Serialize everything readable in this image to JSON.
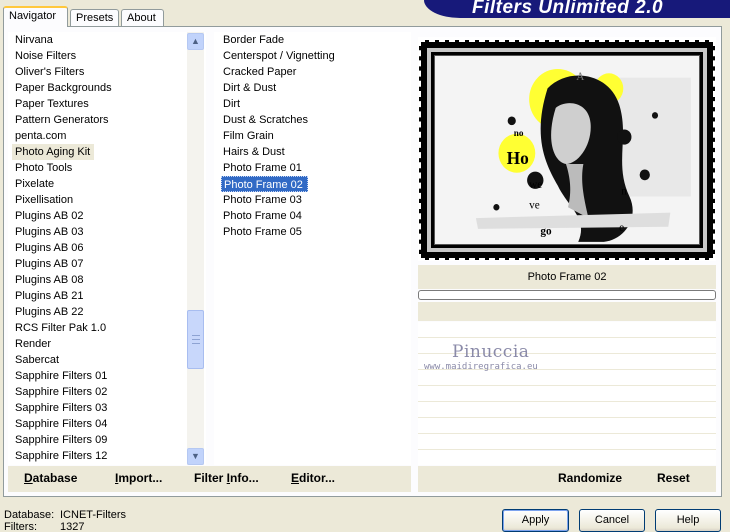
{
  "tabs": [
    "Navigator",
    "Presets",
    "About"
  ],
  "banner_title": "Filters Unlimited 2.0",
  "categories": [
    "Nirvana",
    "Noise Filters",
    "Oliver's Filters",
    "Paper Backgrounds",
    "Paper Textures",
    "Pattern Generators",
    "penta.com",
    "Photo Aging Kit",
    "Photo Tools",
    "Pixelate",
    "Pixellisation",
    "Plugins AB 02",
    "Plugins AB 03",
    "Plugins AB 06",
    "Plugins AB 07",
    "Plugins AB 08",
    "Plugins AB 21",
    "Plugins AB 22",
    "RCS Filter Pak 1.0",
    "Render",
    "Sabercat",
    "Sapphire Filters 01",
    "Sapphire Filters 02",
    "Sapphire Filters 03",
    "Sapphire Filters 04",
    "Sapphire Filters 09",
    "Sapphire Filters 12"
  ],
  "selected_category": "Photo Aging Kit",
  "filters": [
    "Border Fade",
    "Centerspot / Vignetting",
    "Cracked Paper",
    "Dirt & Dust",
    "Dirt",
    "Dust & Scratches",
    "Film Grain",
    "Hairs & Dust",
    "Photo Frame 01",
    "Photo Frame 02",
    "Photo Frame 03",
    "Photo Frame 04",
    "Photo Frame 05"
  ],
  "selected_filter": "Photo Frame 02",
  "preview_filter_name": "Photo Frame 02",
  "preview_text": [
    "no",
    "Ho",
    "we",
    "ve",
    "go",
    "A",
    "n",
    "e"
  ],
  "watermark": {
    "name": "Pinuccia",
    "url": "www.maidiregrafica.eu"
  },
  "actions_left": [
    {
      "label": "Database",
      "underline": "D",
      "rest": "atabase"
    },
    {
      "label": "Import...",
      "underline": "I",
      "rest": "mport..."
    },
    {
      "label": "Filter Info...",
      "pre": "Filter ",
      "underline": "I",
      "rest": "nfo..."
    },
    {
      "label": "Editor...",
      "underline": "E",
      "rest": "ditor..."
    }
  ],
  "actions_right": {
    "randomize": "Randomize",
    "reset": "Reset"
  },
  "footer": {
    "database_label": "Database:",
    "database_value": "ICNET-Filters",
    "filters_label": "Filters:",
    "filters_value": "1327"
  },
  "buttons": {
    "apply": "Apply",
    "cancel": "Cancel",
    "help": "Help"
  },
  "colors": {
    "banner": "#17197a",
    "selection": "#316ac5",
    "accent_yellow": "#ffff33"
  }
}
